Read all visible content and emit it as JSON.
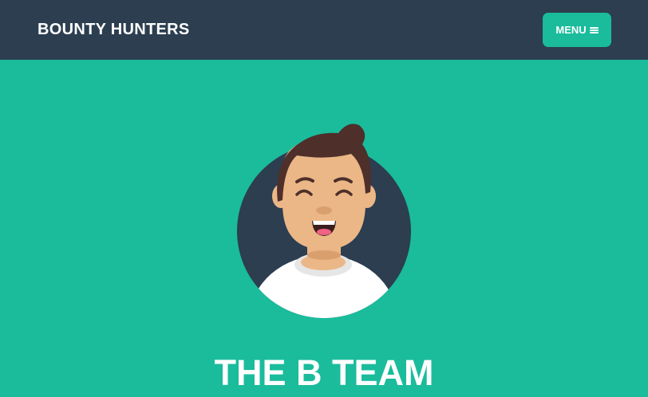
{
  "navbar": {
    "brand": "BOUNTY HUNTERS",
    "menu_label": "MENU",
    "menu_icon": "hamburger-icon"
  },
  "masthead": {
    "avatar_icon": "smiling-person-avatar",
    "title": "THE B TEAM"
  },
  "colors": {
    "navbar_bg": "#2c3e50",
    "accent": "#1abc9c",
    "avatar_circle": "#2c3e50",
    "text": "#ffffff"
  }
}
